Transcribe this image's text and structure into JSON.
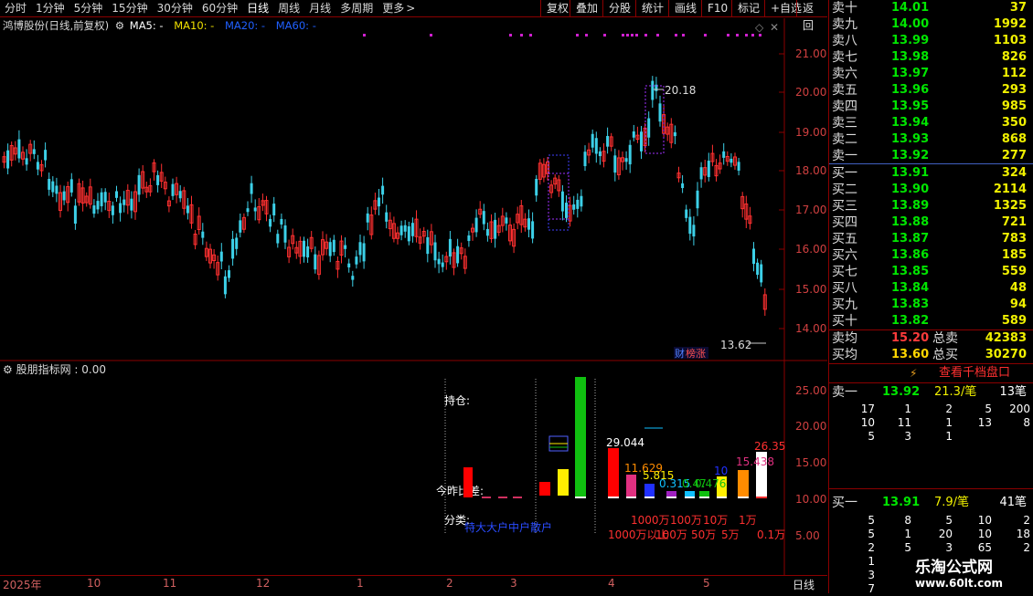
{
  "toolbar": {
    "periods": [
      "分时",
      "1分钟",
      "5分钟",
      "15分钟",
      "30分钟",
      "60分钟",
      "日线",
      "周线",
      "月线",
      "多周期",
      "更多"
    ],
    "active": "日线",
    "more_arrow": ">",
    "right_buttons": [
      "复权",
      "叠加",
      "分股",
      "统计",
      "画线",
      "F10",
      "标记",
      "+自选",
      "返回"
    ]
  },
  "chart": {
    "title": "鸿博股份(日线,前复权)",
    "ma5": "MA5: -",
    "ma10": "MA10: -",
    "ma20": "MA20: -",
    "ma60": "MA60: -",
    "price_ticks": [
      "21.00",
      "20.00",
      "19.00",
      "18.00",
      "17.00",
      "16.00",
      "15.00",
      "14.00"
    ],
    "high_label": "20.18",
    "low_label": "13.62",
    "badge": "财",
    "badge2": "榜涨",
    "colors": {
      "up": "#ff3030",
      "down": "#3cd0e8",
      "bg": "#000000",
      "grid": "#8b0000"
    }
  },
  "indicator": {
    "title": "股朋指标网 : 0.00",
    "ticks": [
      "25.00",
      "20.00",
      "15.00",
      "10.00",
      "5.00"
    ],
    "label_hold": "持仓:",
    "label_diff": "今昨比差:",
    "label_class": "分类:",
    "class_text": "特大大户中户散户",
    "values": [
      "29.044",
      "11.629",
      "5.815",
      "0.315",
      "0.47",
      "0.476",
      "10",
      "15.438",
      "26.35"
    ],
    "amt_labels_top": [
      "1000万",
      "100万",
      "10万",
      "1万"
    ],
    "amt_labels_bot": [
      "1000万以上",
      "100万",
      "50万",
      "5万",
      "0.1万"
    ]
  },
  "xaxis": {
    "labels": [
      "2025年",
      "10",
      "11",
      "12",
      "1",
      "2",
      "3",
      "4",
      "5"
    ],
    "period": "日线"
  },
  "orderbook": {
    "asks": [
      {
        "label": "卖十",
        "price": "14.01",
        "vol": "37"
      },
      {
        "label": "卖九",
        "price": "14.00",
        "vol": "1992"
      },
      {
        "label": "卖八",
        "price": "13.99",
        "vol": "1103"
      },
      {
        "label": "卖七",
        "price": "13.98",
        "vol": "826"
      },
      {
        "label": "卖六",
        "price": "13.97",
        "vol": "112"
      },
      {
        "label": "卖五",
        "price": "13.96",
        "vol": "293"
      },
      {
        "label": "卖四",
        "price": "13.95",
        "vol": "985"
      },
      {
        "label": "卖三",
        "price": "13.94",
        "vol": "350"
      },
      {
        "label": "卖二",
        "price": "13.93",
        "vol": "868"
      },
      {
        "label": "卖一",
        "price": "13.92",
        "vol": "277"
      }
    ],
    "bids": [
      {
        "label": "买一",
        "price": "13.91",
        "vol": "324"
      },
      {
        "label": "买二",
        "price": "13.90",
        "vol": "2114"
      },
      {
        "label": "买三",
        "price": "13.89",
        "vol": "1325"
      },
      {
        "label": "买四",
        "price": "13.88",
        "vol": "721"
      },
      {
        "label": "买五",
        "price": "13.87",
        "vol": "783"
      },
      {
        "label": "买六",
        "price": "13.86",
        "vol": "185"
      },
      {
        "label": "买七",
        "price": "13.85",
        "vol": "559"
      },
      {
        "label": "买八",
        "price": "13.84",
        "vol": "48"
      },
      {
        "label": "买九",
        "price": "13.83",
        "vol": "94"
      },
      {
        "label": "买十",
        "price": "13.82",
        "vol": "589"
      }
    ],
    "avg_sell_label": "卖均",
    "avg_sell": "15.20",
    "total_sell_label": "总卖",
    "total_sell": "42383",
    "avg_buy_label": "买均",
    "avg_buy": "13.60",
    "total_buy_label": "总买",
    "total_buy": "30270",
    "thousand_btn": "查看千档盘口",
    "ask1_label": "卖一",
    "ask1_price": "13.92",
    "ask1_per": "21.3/笔",
    "ask1_count": "13笔",
    "ask_queue": [
      [
        "17",
        "1",
        "2",
        "5",
        "200"
      ],
      [
        "10",
        "11",
        "1",
        "13",
        "8"
      ],
      [
        "5",
        "3",
        "1",
        "",
        ""
      ]
    ],
    "bid1_label": "买一",
    "bid1_price": "13.91",
    "bid1_per": "7.9/笔",
    "bid1_count": "41笔",
    "bid_queue": [
      [
        "5",
        "8",
        "5",
        "10",
        "2"
      ],
      [
        "5",
        "1",
        "20",
        "10",
        "18"
      ],
      [
        "2",
        "5",
        "3",
        "65",
        "2"
      ],
      [
        "1",
        "",
        "",
        "",
        ""
      ],
      [
        "3",
        "",
        "",
        "",
        ""
      ],
      [
        "7",
        "",
        "",
        "",
        ""
      ]
    ]
  },
  "watermark": {
    "title": "乐淘公式网",
    "url": "www.60lt.com"
  }
}
